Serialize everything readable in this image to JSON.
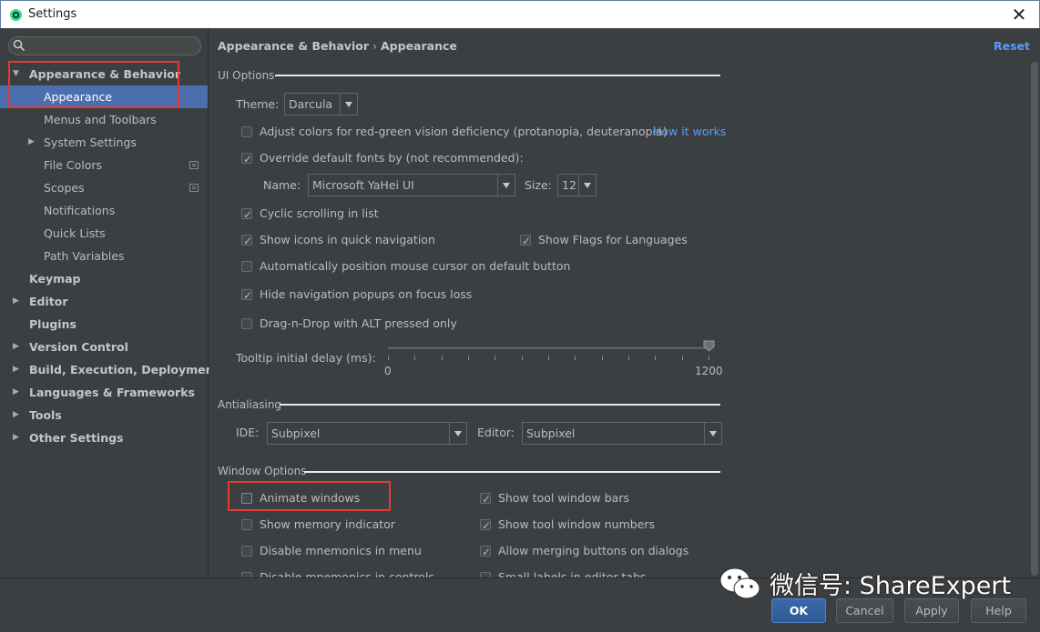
{
  "window": {
    "title": "Settings",
    "close_glyph": "✕"
  },
  "search": {
    "placeholder": "",
    "value": "",
    "icon": "search-icon"
  },
  "sidebar": {
    "items": [
      {
        "label": "Appearance & Behavior",
        "expanded": true
      },
      {
        "label": "Appearance",
        "selected": true
      },
      {
        "label": "Menus and Toolbars"
      },
      {
        "label": "System Settings",
        "expandable": true
      },
      {
        "label": "File Colors",
        "project_icon": true
      },
      {
        "label": "Scopes",
        "project_icon": true
      },
      {
        "label": "Notifications"
      },
      {
        "label": "Quick Lists"
      },
      {
        "label": "Path Variables"
      },
      {
        "label": "Keymap"
      },
      {
        "label": "Editor",
        "expandable": true
      },
      {
        "label": "Plugins"
      },
      {
        "label": "Version Control",
        "expandable": true
      },
      {
        "label": "Build, Execution, Deployment",
        "expandable": true
      },
      {
        "label": "Languages & Frameworks",
        "expandable": true
      },
      {
        "label": "Tools",
        "expandable": true
      },
      {
        "label": "Other Settings",
        "expandable": true
      }
    ]
  },
  "header": {
    "crumb_parent": "Appearance & Behavior",
    "crumb_sep": "›",
    "crumb_current": "Appearance",
    "reset_label": "Reset"
  },
  "ui_options": {
    "section_title": "UI Options",
    "theme_label": "Theme:",
    "theme_value": "Darcula",
    "adjust_colors": {
      "label": "Adjust colors for red-green vision deficiency (protanopia, deuteranopia)",
      "checked": false
    },
    "how_it_works": "How it works",
    "override_fonts": {
      "label": "Override default fonts by (not recommended):",
      "checked": true
    },
    "font_name_label": "Name:",
    "font_name_value": "Microsoft YaHei UI",
    "font_size_label": "Size:",
    "font_size_value": "12",
    "cyclic_scrolling": {
      "label": "Cyclic scrolling in list",
      "checked": true
    },
    "show_icons_nav": {
      "label": "Show icons in quick navigation",
      "checked": true
    },
    "show_flags": {
      "label": "Show Flags for Languages",
      "checked": true
    },
    "auto_position_mouse": {
      "label": "Automatically position mouse cursor on default button",
      "checked": false
    },
    "hide_nav_popups": {
      "label": "Hide navigation popups on focus loss",
      "checked": true
    },
    "drag_n_drop": {
      "label": "Drag-n-Drop with ALT pressed only",
      "checked": false
    },
    "tooltip_label": "Tooltip initial delay (ms):",
    "tooltip_min": "0",
    "tooltip_max": "1200",
    "tooltip_value_fraction": 1.0
  },
  "antialiasing": {
    "section_title": "Antialiasing",
    "ide_label": "IDE:",
    "ide_value": "Subpixel",
    "editor_label": "Editor:",
    "editor_value": "Subpixel"
  },
  "window_options": {
    "section_title": "Window Options",
    "animate_windows": {
      "label": "Animate windows",
      "checked": false
    },
    "show_tool_window_bars": {
      "label": "Show tool window bars",
      "checked": true
    },
    "show_memory_indicator": {
      "label": "Show memory indicator",
      "checked": false
    },
    "show_tool_window_numbers": {
      "label": "Show tool window numbers",
      "checked": true
    },
    "disable_mnemonics_menu": {
      "label": "Disable mnemonics in menu",
      "checked": false
    },
    "allow_merging_buttons": {
      "label": "Allow merging buttons on dialogs",
      "checked": true
    },
    "disable_mnemonics_controls": {
      "label": "Disable mnemonics in controls",
      "checked": false
    },
    "small_labels": {
      "label": "Small labels in editor tabs",
      "checked": false
    }
  },
  "footer": {
    "ok_label": "OK",
    "cancel_label": "Cancel",
    "apply_label": "Apply",
    "help_label": "Help"
  },
  "watermark": {
    "text": "微信号: ShareExpert"
  },
  "colors": {
    "selection": "#4b6eaf",
    "link": "#589df6",
    "highlight_box": "#e53935",
    "background": "#3c3f41"
  }
}
